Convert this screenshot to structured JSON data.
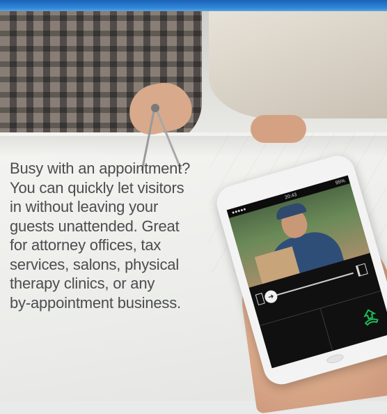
{
  "header": {
    "accent_color": "#2a7bd0"
  },
  "copy": {
    "lines": [
      "Busy with an appointment?",
      "You can quickly let visitors",
      "in without leaving your",
      "guests unattended. Great",
      "for attorney offices, tax",
      "services, salons, physical",
      "therapy clinics, or any",
      "by-appointment business."
    ],
    "text_color": "#4b4c4e"
  },
  "phone": {
    "status_carrier": "●●●●●",
    "status_time": "20:43",
    "status_battery": "95%",
    "icons": {
      "door_closed": "door-closed-icon",
      "door_open": "door-open-icon",
      "slider_arrow": "arrow-right-icon",
      "hangup": "hangup-phone-icon"
    },
    "accent_color": "#1db954"
  }
}
